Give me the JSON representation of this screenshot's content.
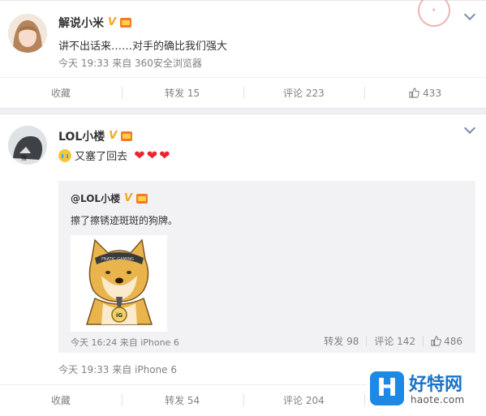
{
  "post1": {
    "username": "解说小米",
    "text": "讲不出话来……对手的确比我们强大",
    "meta": "今天 19:33 来自 360安全浏览器",
    "actions": {
      "favorite": "收藏",
      "repost": "转发 15",
      "comment": "评论 223",
      "like": "433"
    }
  },
  "post2": {
    "username": "LOL小楼",
    "text": "又塞了回去",
    "meta": "今天 19:33 来自 iPhone 6",
    "repost": {
      "username": "@LOL小楼",
      "text": "擦了擦锈迹斑斑的狗牌。",
      "meta": "今天 16:24 来自 iPhone 6",
      "repost_count": "转发 98",
      "comment_count": "评论 142",
      "like_count": "486"
    },
    "actions": {
      "favorite": "收藏",
      "repost": "转发 54",
      "comment": "评论 204"
    }
  },
  "watermark": {
    "title": "好特网",
    "url": "haote.com",
    "logo": "H"
  },
  "colors": {
    "link_gray": "#808080",
    "repost_bg": "#f2f2f5",
    "heart": "#e8262c",
    "verified": "#f5a623"
  },
  "icons": [
    "chevron-down-icon",
    "verified-v-icon",
    "gift-badge-icon",
    "thumb-up-icon",
    "crying-emoji-icon",
    "heart-emoji-icon"
  ]
}
